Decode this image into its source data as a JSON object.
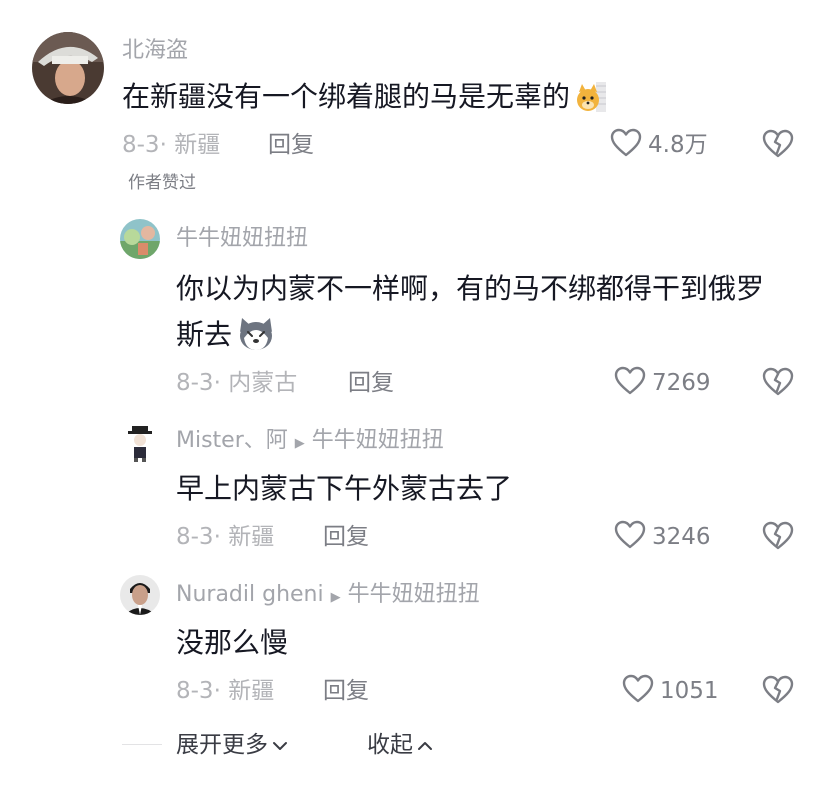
{
  "comments": [
    {
      "username": "北海盗",
      "text": "在新疆没有一个绑着腿的马是无辜的",
      "date": "8-3",
      "location": "新疆",
      "reply_label": "回复",
      "likes": "4.8万",
      "tag": "作者赞过",
      "emoji": "dog-emoji"
    },
    {
      "username": "牛牛妞妞扭扭",
      "text_line1": "你以为内蒙不一样啊，有的马不绑都得干到俄罗",
      "text_line2": "斯去",
      "date": "8-3",
      "location": "内蒙古",
      "reply_label": "回复",
      "likes": "7269",
      "emoji": "husky-emoji"
    },
    {
      "username": "Mister、阿",
      "reply_to": "牛牛妞妞扭扭",
      "text": "早上内蒙古下午外蒙古去了",
      "date": "8-3",
      "location": "新疆",
      "reply_label": "回复",
      "likes": "3246"
    },
    {
      "username": "Nuradil gheni",
      "reply_to": "牛牛妞妞扭扭",
      "text": "没那么慢",
      "date": "8-3",
      "location": "新疆",
      "reply_label": "回复",
      "likes": "1051"
    }
  ],
  "footer": {
    "expand_label": "展开更多",
    "collapse_label": "收起"
  },
  "colors": {
    "text": "#161823",
    "muted": "#a3a5ab",
    "icon": "#7c7e85"
  }
}
